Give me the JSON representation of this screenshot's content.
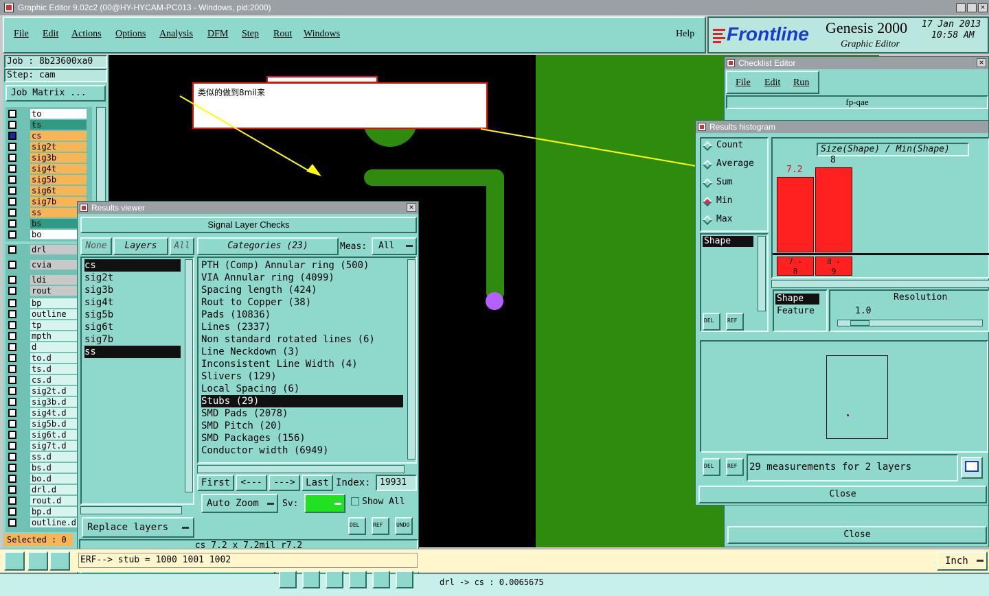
{
  "app_title": "Graphic Editor 9.02c2 (00@HY-HYCAM-PC013 - Windows, pid:2000)",
  "menu": [
    "File",
    "Edit",
    "Actions",
    "Options",
    "Analysis",
    "DFM",
    "Step",
    "Rout",
    "Windows"
  ],
  "help_label": "Help",
  "brand": {
    "logo": "Frontline",
    "product": "Genesis 2000",
    "subtitle": "Graphic Editor",
    "date": "17 Jan 2013",
    "time": "10:58 AM"
  },
  "job": "Job  : 8b23600xa0",
  "step": "Step: cam",
  "job_matrix": "Job Matrix ...",
  "layers": [
    {
      "name": "to",
      "color": "#ffffff"
    },
    {
      "name": "ts",
      "color": "#2f9a86"
    },
    {
      "name": "cs",
      "color": "#f9b456"
    },
    {
      "name": "sig2t",
      "color": "#f9b456"
    },
    {
      "name": "sig3b",
      "color": "#f9b456"
    },
    {
      "name": "sig4t",
      "color": "#f9b456"
    },
    {
      "name": "sig5b",
      "color": "#f9b456"
    },
    {
      "name": "sig6t",
      "color": "#f9b456"
    },
    {
      "name": "sig7b",
      "color": "#f9b456"
    },
    {
      "name": "ss",
      "color": "#f9b456"
    },
    {
      "name": "bs",
      "color": "#2f9a86"
    },
    {
      "name": "bo",
      "color": "#ffffff"
    }
  ],
  "layers2": [
    "drl",
    "cvia",
    "ldi",
    "rout",
    "bp",
    "outline",
    "tp",
    "mpth",
    "d",
    "to.d",
    "ts.d",
    "cs.d",
    "sig2t.d",
    "sig3b.d",
    "sig4t.d",
    "sig5b.d",
    "sig6t.d",
    "sig7t.d",
    "ss.d",
    "bs.d",
    "bo.d",
    "drl.d",
    "rout.d",
    "bp.d",
    "outline.d"
  ],
  "selected": "Selected : 0",
  "annotation": "类似的做到8mil来",
  "checklist": {
    "title": "Checklist Editor",
    "menu": [
      "File",
      "Edit",
      "Run"
    ],
    "name": "fp-qae",
    "close": "Close"
  },
  "histogram": {
    "title": "Results histogram",
    "modes": [
      "Count",
      "Average",
      "Sum",
      "Min",
      "Max"
    ],
    "selected_mode": "Min",
    "chart_title": "Size(Shape) / Min(Shape)",
    "left_list": [
      "Shape"
    ],
    "bars": [
      {
        "label": "7.2",
        "range": "7 - 8"
      },
      {
        "label": "8",
        "range": "8 - 9"
      }
    ],
    "kind_list": [
      "Shape",
      "Feature"
    ],
    "resolution_label": "Resolution",
    "resolution": "1.0",
    "status": "29 measurements for 2 layers",
    "close": "Close",
    "del": "DEL",
    "ref": "REF"
  },
  "results": {
    "title": "Results viewer",
    "header": "Signal Layer Checks",
    "none": "None",
    "layers": "Layers",
    "all": "All",
    "categories_label": "Categories (23)",
    "meas_label": "Meas:",
    "meas_value": "All",
    "layer_list": [
      "cs",
      "sig2t",
      "sig3b",
      "sig4t",
      "sig5b",
      "sig6t",
      "sig7b",
      "ss"
    ],
    "categories": [
      "PTH (Comp) Annular ring (500)",
      "VIA Annular ring (4099)",
      "Spacing length (424)",
      "Rout to Copper (38)",
      "Pads (10836)",
      "Lines (2337)",
      "Non standard rotated lines (6)",
      "Line Neckdown (3)",
      "Inconsistent Line Width (4)",
      "Slivers (129)",
      "Local Spacing (6)",
      "Stubs (29)",
      "SMD Pads (2078)",
      "SMD Pitch (20)",
      "SMD Packages (156)",
      "Conductor width (6949)"
    ],
    "selected_category": "Stubs (29)",
    "first": "First",
    "prev": "<---",
    "next": "--->",
    "last": "Last",
    "index_label": "Index:",
    "index_value": "19931",
    "auto_zoom": "Auto Zoom",
    "sv": "Sv:",
    "show_all": "Show All",
    "replace_layers": "Replace layers",
    "info": "cs 7.2 x 7.2mil   r7.2",
    "close": "Close",
    "del": "DEL",
    "ref": "REF",
    "undo": "UNDO"
  },
  "erf_line": "ERF--> stub = 1000 1001 1002",
  "status_bottom": "drl -> cs : 0.0065675",
  "units": "Inch",
  "hist_close2": "Close"
}
